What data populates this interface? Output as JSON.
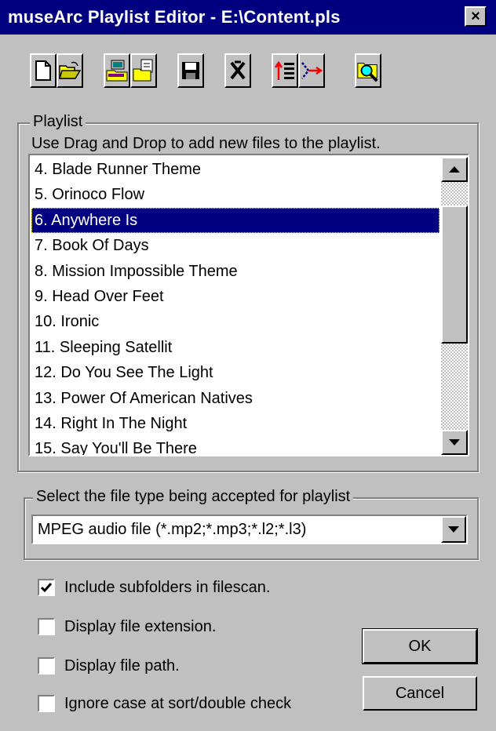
{
  "window": {
    "title": "museArc Playlist Editor - E:\\Content.pls",
    "close_label": "×"
  },
  "toolbar": {
    "buttons": [
      {
        "icon": "new-file-icon"
      },
      {
        "icon": "open-folder-icon"
      },
      {
        "icon": "network-drive-icon"
      },
      {
        "icon": "copy-files-icon"
      },
      {
        "icon": "save-icon"
      },
      {
        "icon": "delete-icon"
      },
      {
        "icon": "sort-icon"
      },
      {
        "icon": "merge-icon"
      },
      {
        "icon": "search-icon"
      }
    ]
  },
  "playlist": {
    "group_label": "Playlist",
    "hint": "Use Drag and Drop to add new files to the playlist.",
    "items": [
      "4. Blade Runner Theme",
      "5. Orinoco Flow",
      "6. Anywhere Is",
      "7. Book Of Days",
      "8. Mission Impossible Theme",
      "9. Head Over Feet",
      "10. Ironic",
      "11. Sleeping Satellit",
      "12. Do You See The Light",
      "13. Power Of American Natives",
      "14. Right In The Night",
      "15. Say You'll Be There"
    ],
    "selected_index": 2
  },
  "filetype": {
    "group_label": "Select the file type being accepted for playlist",
    "selected": "MPEG audio file (*.mp2;*.mp3;*.l2;*.l3)"
  },
  "options": [
    {
      "label": "Include subfolders in filescan.",
      "checked": true
    },
    {
      "label": "Display file extension.",
      "checked": false
    },
    {
      "label": "Display file path.",
      "checked": false
    },
    {
      "label": "Ignore case at sort/double check",
      "checked": false
    }
  ],
  "buttons": {
    "ok": "OK",
    "cancel": "Cancel"
  },
  "colors": {
    "titlebar": "#000080",
    "selection": "#000080",
    "face": "#c0c0c0"
  }
}
